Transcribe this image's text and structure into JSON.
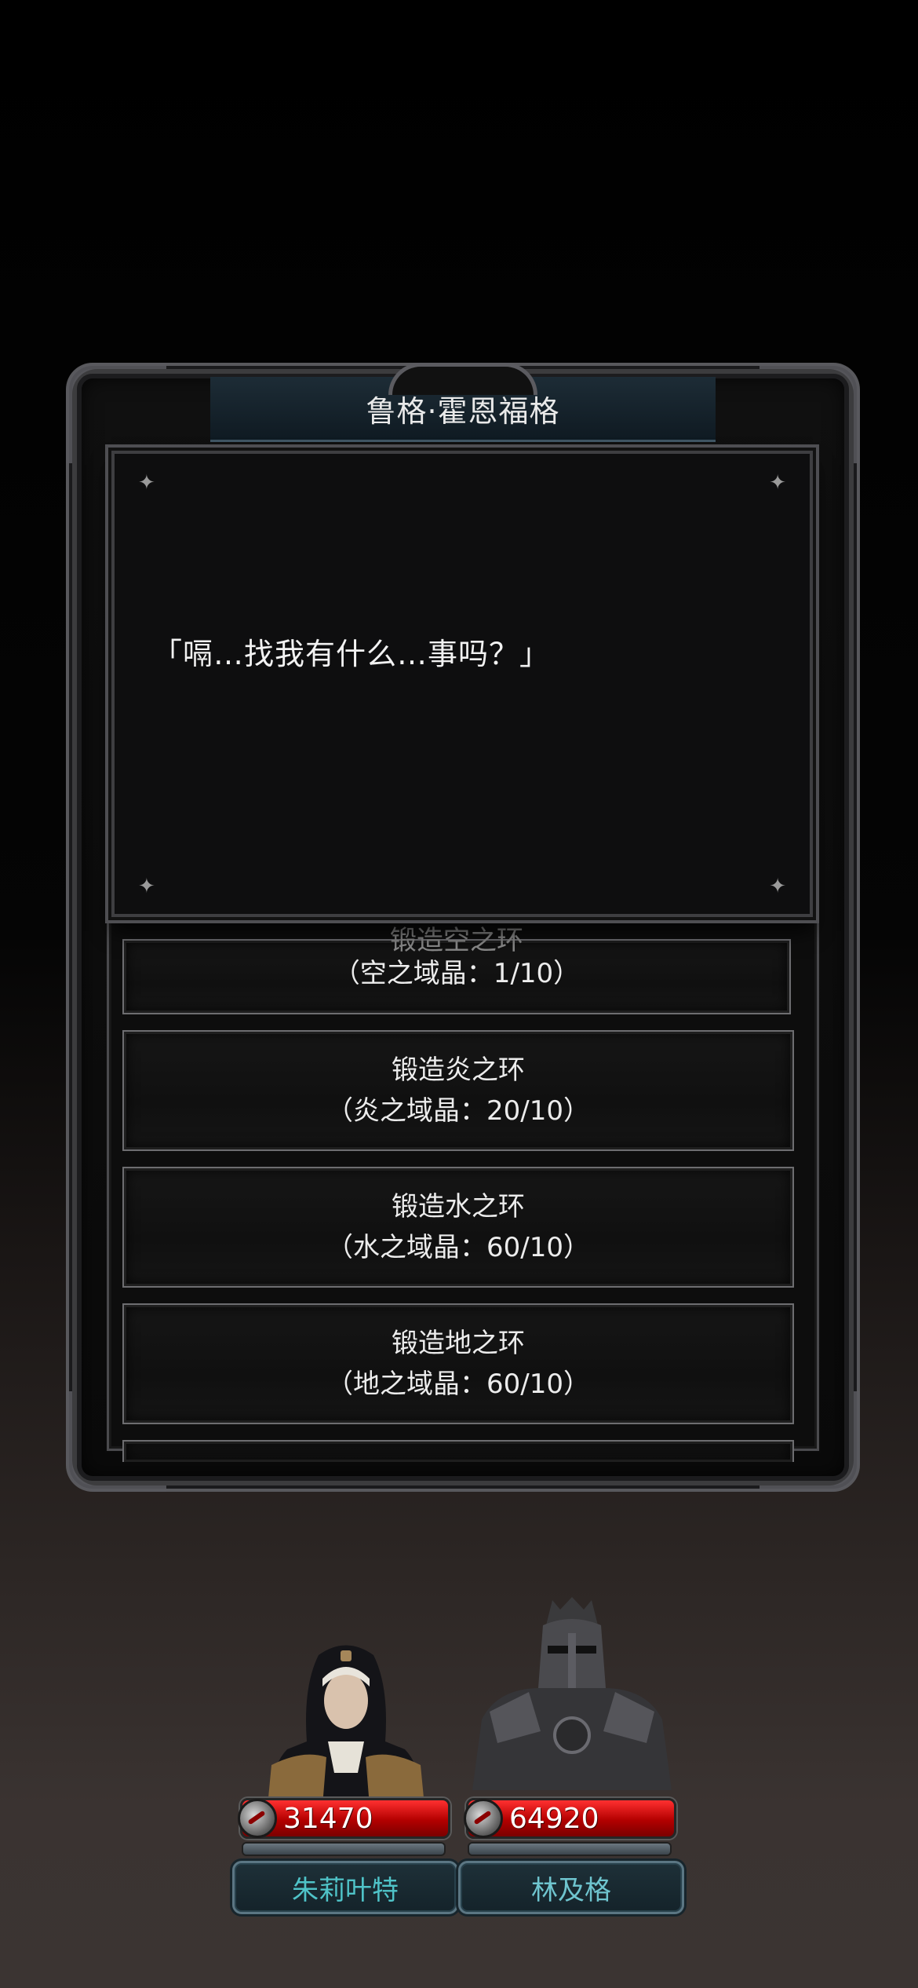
{
  "dialog": {
    "npc_name": "鲁格·霍恩福格",
    "speech": "「嗝…找我有什么…事吗？」"
  },
  "options": [
    {
      "title": "锻造空之环",
      "cost": "（空之域晶：1/10）"
    },
    {
      "title": "锻造炎之环",
      "cost": "（炎之域晶：20/10）"
    },
    {
      "title": "锻造水之环",
      "cost": "（水之域晶：60/10）"
    },
    {
      "title": "锻造地之环",
      "cost": "（地之域晶：60/10）"
    }
  ],
  "party": [
    {
      "name": "朱莉叶特",
      "hp": "31470",
      "portrait": "nun-portrait",
      "name_color": "#4fc3c8"
    },
    {
      "name": "林及格",
      "hp": "64920",
      "portrait": "armored-knight-portrait",
      "name_color": "#6fc5cf"
    }
  ],
  "colors": {
    "hp_red": "#c00000",
    "name_teal": "#4fc3c8",
    "frame_grey": "#5a5a5f"
  }
}
